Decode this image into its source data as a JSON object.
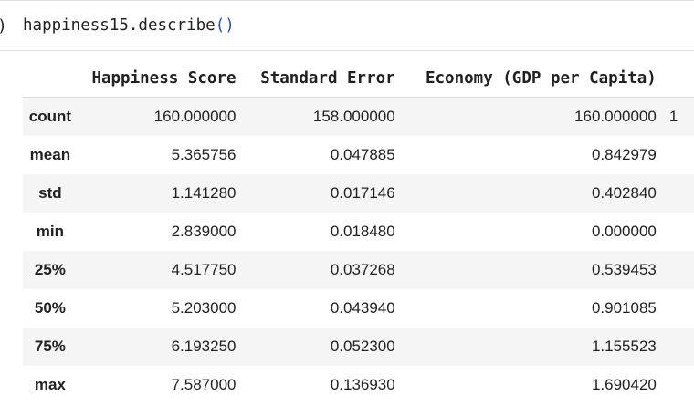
{
  "code_cell": {
    "prompt_fragment": ")",
    "code_text": "happiness15.describe",
    "code_parens": "()"
  },
  "dataframe": {
    "columns": [
      "Happiness Score",
      "Standard Error",
      "Economy (GDP per Capita)"
    ],
    "cut_off_column_glyph": "1",
    "rows": [
      {
        "label": "count",
        "values": [
          "160.000000",
          "158.000000",
          "160.000000"
        ]
      },
      {
        "label": "mean",
        "values": [
          "5.365756",
          "0.047885",
          "0.842979"
        ]
      },
      {
        "label": "std",
        "values": [
          "1.141280",
          "0.017146",
          "0.402840"
        ]
      },
      {
        "label": "min",
        "values": [
          "2.839000",
          "0.018480",
          "0.000000"
        ]
      },
      {
        "label": "25%",
        "values": [
          "4.517750",
          "0.037268",
          "0.539453"
        ]
      },
      {
        "label": "50%",
        "values": [
          "5.203000",
          "0.043940",
          "0.901085"
        ]
      },
      {
        "label": "75%",
        "values": [
          "6.193250",
          "0.052300",
          "1.155523"
        ]
      },
      {
        "label": "max",
        "values": [
          "7.587000",
          "0.136930",
          "1.690420"
        ]
      }
    ]
  },
  "colors": {
    "stripe": "#f5f5f5",
    "paren": "#1a4fd1"
  }
}
